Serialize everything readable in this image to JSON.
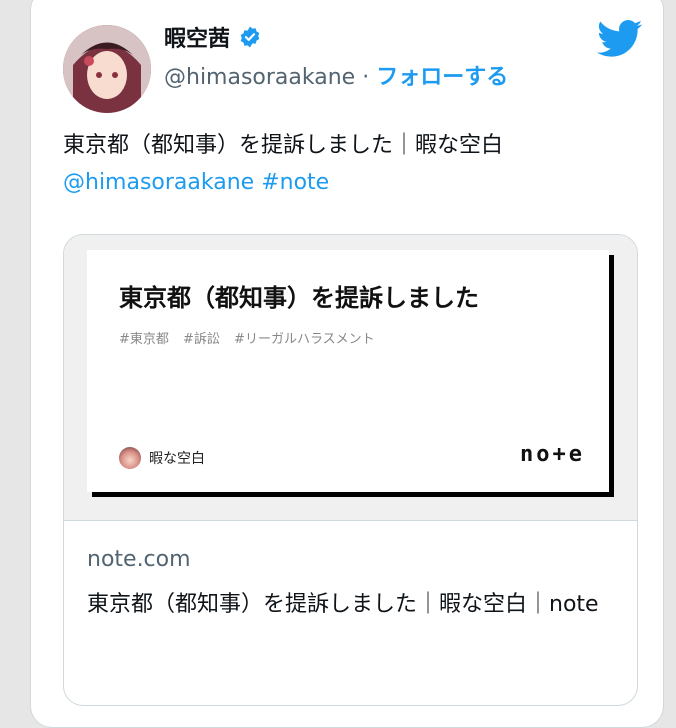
{
  "tweet": {
    "display_name": "暇空茜",
    "handle": "@himasoraakane",
    "separator": " · ",
    "follow_label": "フォローする",
    "text_line1": "東京都（都知事）を提訴しました｜暇な空白",
    "mention": "@himasoraakane",
    "hashtag": "#note"
  },
  "link_card": {
    "image": {
      "title": "東京都（都知事）を提訴しました",
      "tags": "#東京都 #訴訟 #リーガルハラスメント",
      "author": "暇な空白",
      "logo_text": "no+e"
    },
    "domain": "note.com",
    "title": "東京都（都知事）を提訴しました｜暇な空白｜note"
  },
  "colors": {
    "twitter_blue": "#1d9bf0",
    "verified_blue": "#1d9bf0",
    "text_primary": "#0f1419",
    "text_secondary": "#536471"
  },
  "icons": {
    "twitter": "twitter-bird-icon",
    "verified": "verified-badge-icon"
  }
}
